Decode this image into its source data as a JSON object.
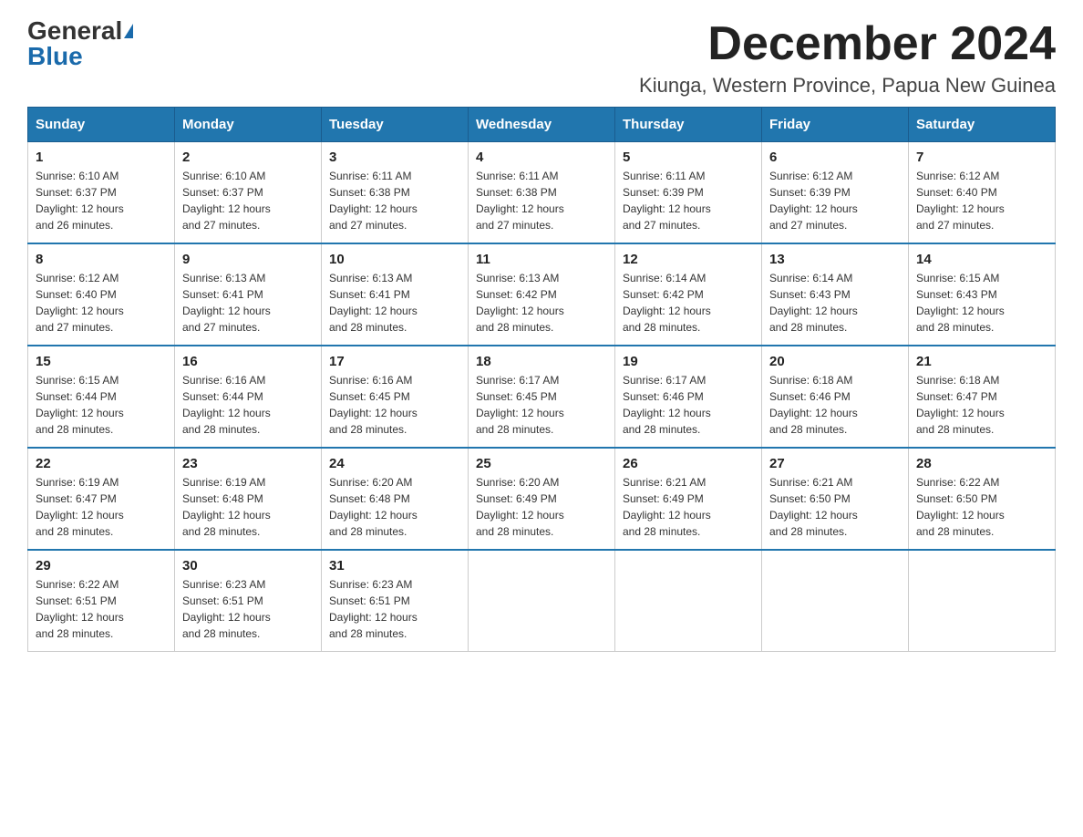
{
  "logo": {
    "general": "General",
    "blue": "Blue"
  },
  "title": {
    "month": "December 2024",
    "location": "Kiunga, Western Province, Papua New Guinea"
  },
  "days_header": [
    "Sunday",
    "Monday",
    "Tuesday",
    "Wednesday",
    "Thursday",
    "Friday",
    "Saturday"
  ],
  "weeks": [
    [
      {
        "day": "1",
        "sunrise": "6:10 AM",
        "sunset": "6:37 PM",
        "daylight": "12 hours and 26 minutes."
      },
      {
        "day": "2",
        "sunrise": "6:10 AM",
        "sunset": "6:37 PM",
        "daylight": "12 hours and 27 minutes."
      },
      {
        "day": "3",
        "sunrise": "6:11 AM",
        "sunset": "6:38 PM",
        "daylight": "12 hours and 27 minutes."
      },
      {
        "day": "4",
        "sunrise": "6:11 AM",
        "sunset": "6:38 PM",
        "daylight": "12 hours and 27 minutes."
      },
      {
        "day": "5",
        "sunrise": "6:11 AM",
        "sunset": "6:39 PM",
        "daylight": "12 hours and 27 minutes."
      },
      {
        "day": "6",
        "sunrise": "6:12 AM",
        "sunset": "6:39 PM",
        "daylight": "12 hours and 27 minutes."
      },
      {
        "day": "7",
        "sunrise": "6:12 AM",
        "sunset": "6:40 PM",
        "daylight": "12 hours and 27 minutes."
      }
    ],
    [
      {
        "day": "8",
        "sunrise": "6:12 AM",
        "sunset": "6:40 PM",
        "daylight": "12 hours and 27 minutes."
      },
      {
        "day": "9",
        "sunrise": "6:13 AM",
        "sunset": "6:41 PM",
        "daylight": "12 hours and 27 minutes."
      },
      {
        "day": "10",
        "sunrise": "6:13 AM",
        "sunset": "6:41 PM",
        "daylight": "12 hours and 28 minutes."
      },
      {
        "day": "11",
        "sunrise": "6:13 AM",
        "sunset": "6:42 PM",
        "daylight": "12 hours and 28 minutes."
      },
      {
        "day": "12",
        "sunrise": "6:14 AM",
        "sunset": "6:42 PM",
        "daylight": "12 hours and 28 minutes."
      },
      {
        "day": "13",
        "sunrise": "6:14 AM",
        "sunset": "6:43 PM",
        "daylight": "12 hours and 28 minutes."
      },
      {
        "day": "14",
        "sunrise": "6:15 AM",
        "sunset": "6:43 PM",
        "daylight": "12 hours and 28 minutes."
      }
    ],
    [
      {
        "day": "15",
        "sunrise": "6:15 AM",
        "sunset": "6:44 PM",
        "daylight": "12 hours and 28 minutes."
      },
      {
        "day": "16",
        "sunrise": "6:16 AM",
        "sunset": "6:44 PM",
        "daylight": "12 hours and 28 minutes."
      },
      {
        "day": "17",
        "sunrise": "6:16 AM",
        "sunset": "6:45 PM",
        "daylight": "12 hours and 28 minutes."
      },
      {
        "day": "18",
        "sunrise": "6:17 AM",
        "sunset": "6:45 PM",
        "daylight": "12 hours and 28 minutes."
      },
      {
        "day": "19",
        "sunrise": "6:17 AM",
        "sunset": "6:46 PM",
        "daylight": "12 hours and 28 minutes."
      },
      {
        "day": "20",
        "sunrise": "6:18 AM",
        "sunset": "6:46 PM",
        "daylight": "12 hours and 28 minutes."
      },
      {
        "day": "21",
        "sunrise": "6:18 AM",
        "sunset": "6:47 PM",
        "daylight": "12 hours and 28 minutes."
      }
    ],
    [
      {
        "day": "22",
        "sunrise": "6:19 AM",
        "sunset": "6:47 PM",
        "daylight": "12 hours and 28 minutes."
      },
      {
        "day": "23",
        "sunrise": "6:19 AM",
        "sunset": "6:48 PM",
        "daylight": "12 hours and 28 minutes."
      },
      {
        "day": "24",
        "sunrise": "6:20 AM",
        "sunset": "6:48 PM",
        "daylight": "12 hours and 28 minutes."
      },
      {
        "day": "25",
        "sunrise": "6:20 AM",
        "sunset": "6:49 PM",
        "daylight": "12 hours and 28 minutes."
      },
      {
        "day": "26",
        "sunrise": "6:21 AM",
        "sunset": "6:49 PM",
        "daylight": "12 hours and 28 minutes."
      },
      {
        "day": "27",
        "sunrise": "6:21 AM",
        "sunset": "6:50 PM",
        "daylight": "12 hours and 28 minutes."
      },
      {
        "day": "28",
        "sunrise": "6:22 AM",
        "sunset": "6:50 PM",
        "daylight": "12 hours and 28 minutes."
      }
    ],
    [
      {
        "day": "29",
        "sunrise": "6:22 AM",
        "sunset": "6:51 PM",
        "daylight": "12 hours and 28 minutes."
      },
      {
        "day": "30",
        "sunrise": "6:23 AM",
        "sunset": "6:51 PM",
        "daylight": "12 hours and 28 minutes."
      },
      {
        "day": "31",
        "sunrise": "6:23 AM",
        "sunset": "6:51 PM",
        "daylight": "12 hours and 28 minutes."
      },
      null,
      null,
      null,
      null
    ]
  ],
  "labels": {
    "sunrise": "Sunrise:",
    "sunset": "Sunset:",
    "daylight": "Daylight:"
  }
}
